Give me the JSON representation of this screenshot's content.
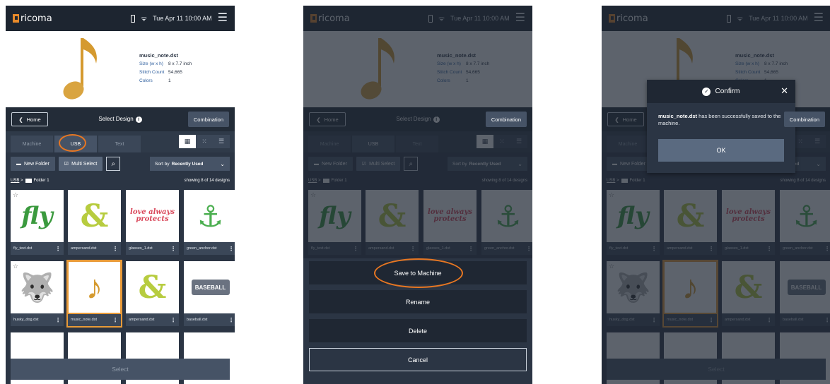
{
  "status": {
    "brand": "ricoma",
    "datetime": "Tue Apr 11  10:00 AM"
  },
  "design": {
    "filename": "music_note.dst",
    "size_label": "Size (w x h)",
    "size_value": "8 x 7.7 inch",
    "stitch_label": "Stitch Count",
    "stitch_value": "54,665",
    "colors_label": "Colors",
    "colors_value": "1"
  },
  "titlebar": {
    "home": "Home",
    "title": "Select Design",
    "combination": "Combination"
  },
  "tabs": [
    "Machine",
    "USB",
    "Text"
  ],
  "toolbar": {
    "new_folder": "New Folder",
    "multi_select": "Multi Select",
    "sort_prefix": "Sort by",
    "sort_value": "Recently Used"
  },
  "breadcrumb": {
    "root": "USB",
    "folder": "Folder 1",
    "count": "showing 8 of 14 designs"
  },
  "designs": [
    {
      "name": "fly_text.dst",
      "art": "fly"
    },
    {
      "name": "ampersand.dst",
      "art": "&"
    },
    {
      "name": "glasses_1.dst",
      "art": "love always protects"
    },
    {
      "name": "green_anchor.dst",
      "art": "⚓"
    },
    {
      "name": "husky_dog.dst",
      "art": "🐺"
    },
    {
      "name": "music_note.dst",
      "art": "♪"
    },
    {
      "name": "ampersand.dst",
      "art": "&"
    },
    {
      "name": "baseball.dst",
      "art": "BASEBALL"
    }
  ],
  "select_button": "Select",
  "actions": {
    "save": "Save to Machine",
    "rename": "Rename",
    "delete": "Delete",
    "cancel": "Cancel"
  },
  "confirm": {
    "title": "Confirm",
    "file": "music_note.dst",
    "message": " has been successfully saved to the machine.",
    "ok": "OK"
  },
  "colors": {
    "accent": "#e87722",
    "panel": "#2b3544",
    "header": "#1d2530"
  }
}
